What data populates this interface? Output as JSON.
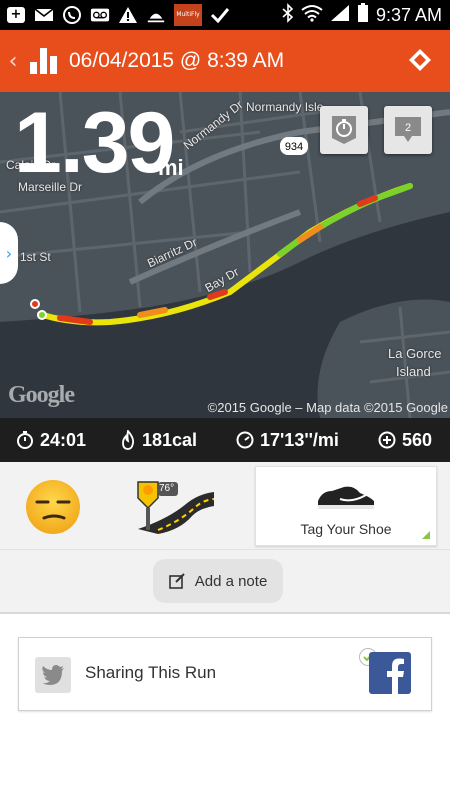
{
  "status_bar": {
    "time": "9:37 AM",
    "app_badge": "MultiFly",
    "icons": [
      "add-icon",
      "mail-icon",
      "whatsapp-icon",
      "voicemail-icon",
      "warning-icon",
      "weather-icon",
      "app-icon",
      "check-icon",
      "bluetooth-icon",
      "wifi-icon",
      "signal-icon",
      "battery-icon"
    ]
  },
  "header": {
    "title": "06/04/2015 @ 8:39 AM",
    "back_icon": "chevron-left-icon",
    "stats_icon": "bar-chart-icon",
    "share_icon": "diamond-icon",
    "color": "#e84e1c"
  },
  "map": {
    "distance": "1.39",
    "unit": "mi",
    "labels": [
      "Normandy Isle",
      "Normandy Dr",
      "Calais Dr",
      "Marseille Dr",
      "1st St",
      "Biarritz Dr",
      "Bay Dr",
      "La Gorce",
      "Island"
    ],
    "road_shield": "934",
    "comments_count": "2",
    "google_logo": "Google",
    "copyright": "©2015 Google – Map data ©2015 Google",
    "buttons": [
      "stopwatch-icon",
      "comment-icon"
    ]
  },
  "stats": {
    "duration": "24:01",
    "calories": "181cal",
    "pace": "17'13''/mi",
    "fuel": "560",
    "icons": [
      "stopwatch-icon",
      "flame-icon",
      "speedometer-icon",
      "fuel-icon"
    ]
  },
  "details": {
    "mood_icon": "unamused-face-icon",
    "weather": {
      "temperature": "76°",
      "icon": "sunny-road-icon"
    },
    "shoe_label": "Tag Your Shoe",
    "note_label": "Add a note",
    "note_icon": "edit-icon"
  },
  "sharing": {
    "label": "Sharing This Run",
    "twitter_icon": "twitter-icon",
    "facebook_icon": "facebook-icon",
    "facebook_color": "#3b5998"
  }
}
